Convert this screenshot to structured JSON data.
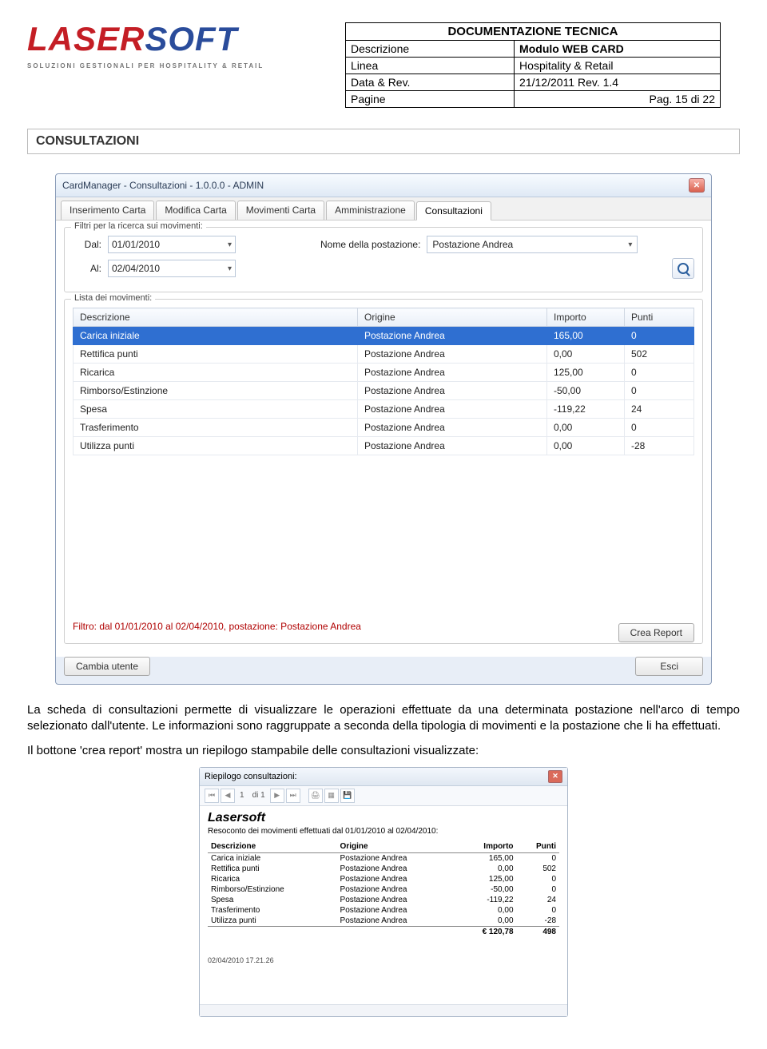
{
  "header": {
    "logo_a": "LASER",
    "logo_b": "SOFT",
    "logo_sub": "SOLUZIONI GESTIONALI PER HOSPITALITY & RETAIL",
    "title": "DOCUMENTAZIONE TECNICA",
    "rows": [
      {
        "k": "Descrizione",
        "v": "Modulo WEB CARD",
        "vbold": true
      },
      {
        "k": "Linea",
        "v": "Hospitality & Retail"
      },
      {
        "k": "Data & Rev.",
        "v": "21/12/2011  Rev. 1.4"
      },
      {
        "k": "Pagine",
        "v": "Pag. 15 di  22"
      }
    ]
  },
  "section_title": "CONSULTAZIONI",
  "win1": {
    "title": "CardManager - Consultazioni - 1.0.0.0 - ADMIN",
    "tabs": [
      "Inserimento Carta",
      "Modifica Carta",
      "Movimenti Carta",
      "Amministrazione",
      "Consultazioni"
    ],
    "active_tab": 4,
    "filter_legend": "Filtri per la ricerca sui movimenti:",
    "lbl_dal": "Dal:",
    "lbl_al": "Al:",
    "date_from": "01/01/2010",
    "date_to": "02/04/2010",
    "lbl_post": "Nome della postazione:",
    "postazione": "Postazione Andrea",
    "list_legend": "Lista dei movimenti:",
    "cols": {
      "desc": "Descrizione",
      "orig": "Origine",
      "imp": "Importo",
      "pun": "Punti"
    },
    "rows": [
      {
        "desc": "Carica iniziale",
        "orig": "Postazione Andrea",
        "imp": "165,00",
        "pun": "0",
        "sel": true
      },
      {
        "desc": "Rettifica punti",
        "orig": "Postazione Andrea",
        "imp": "0,00",
        "pun": "502"
      },
      {
        "desc": "Ricarica",
        "orig": "Postazione Andrea",
        "imp": "125,00",
        "pun": "0"
      },
      {
        "desc": "Rimborso/Estinzione",
        "orig": "Postazione Andrea",
        "imp": "-50,00",
        "pun": "0"
      },
      {
        "desc": "Spesa",
        "orig": "Postazione Andrea",
        "imp": "-119,22",
        "pun": "24"
      },
      {
        "desc": "Trasferimento",
        "orig": "Postazione Andrea",
        "imp": "0,00",
        "pun": "0"
      },
      {
        "desc": "Utilizza punti",
        "orig": "Postazione Andrea",
        "imp": "0,00",
        "pun": "-28"
      }
    ],
    "status": "Filtro: dal 01/01/2010 al 02/04/2010, postazione: Postazione Andrea",
    "btn_report": "Crea Report",
    "btn_user": "Cambia utente",
    "btn_exit": "Esci"
  },
  "para1": "La scheda di consultazioni permette di visualizzare le operazioni effettuate da una determinata postazione nell'arco di tempo selezionato dall'utente. Le informazioni sono raggruppate a seconda della tipologia di movimenti e la postazione che li ha effettuati.",
  "para2": "Il bottone 'crea report' mostra un riepilogo stampabile delle consultazioni visualizzate:",
  "report": {
    "title": "Riepilogo consultazioni:",
    "nav_page": "1",
    "nav_of": "di 1",
    "company": "Lasersoft",
    "subtitle": "Resoconto dei movimenti effettuati dal 01/01/2010 al 02/04/2010:",
    "cols": {
      "desc": "Descrizione",
      "orig": "Origine",
      "imp": "Importo",
      "pun": "Punti"
    },
    "rows": [
      {
        "desc": "Carica iniziale",
        "orig": "Postazione Andrea",
        "imp": "165,00",
        "pun": "0"
      },
      {
        "desc": "Rettifica punti",
        "orig": "Postazione Andrea",
        "imp": "0,00",
        "pun": "502"
      },
      {
        "desc": "Ricarica",
        "orig": "Postazione Andrea",
        "imp": "125,00",
        "pun": "0"
      },
      {
        "desc": "Rimborso/Estinzione",
        "orig": "Postazione Andrea",
        "imp": "-50,00",
        "pun": "0"
      },
      {
        "desc": "Spesa",
        "orig": "Postazione Andrea",
        "imp": "-119,22",
        "pun": "24"
      },
      {
        "desc": "Trasferimento",
        "orig": "Postazione Andrea",
        "imp": "0,00",
        "pun": "0"
      },
      {
        "desc": "Utilizza punti",
        "orig": "Postazione Andrea",
        "imp": "0,00",
        "pun": "-28"
      }
    ],
    "total_imp": "€ 120,78",
    "total_pun": "498",
    "timestamp": "02/04/2010 17.21.26"
  }
}
